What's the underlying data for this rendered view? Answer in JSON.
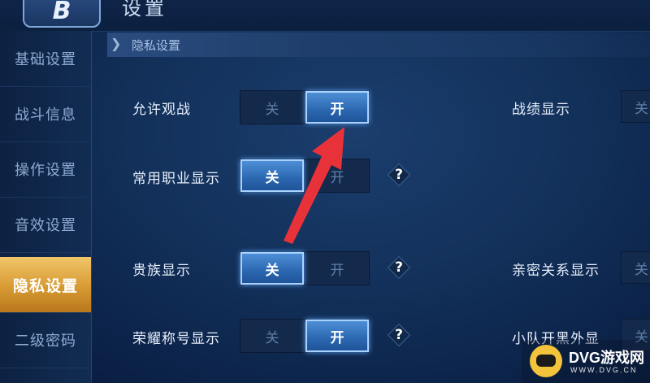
{
  "header": {
    "logo_letter": "B",
    "title": "设置"
  },
  "sidebar": {
    "items": [
      {
        "label": "基础设置",
        "active": false
      },
      {
        "label": "战斗信息",
        "active": false
      },
      {
        "label": "操作设置",
        "active": false
      },
      {
        "label": "音效设置",
        "active": false
      },
      {
        "label": "隐私设置",
        "active": true
      },
      {
        "label": "二级密码",
        "active": false
      }
    ]
  },
  "section": {
    "title": "隐私设置"
  },
  "toggle_labels": {
    "off": "关",
    "on": "开"
  },
  "settings": [
    {
      "label": "允许观战",
      "value": "开",
      "help": ""
    },
    {
      "label": "常用职业显示",
      "value": "关",
      "help": "?"
    },
    {
      "label": "贵族显示",
      "value": "关",
      "help": "?"
    },
    {
      "label": "荣耀称号显示",
      "value": "开",
      "help": "?"
    }
  ],
  "right_settings": [
    {
      "label": "战绩显示",
      "stub": "关"
    },
    {
      "label": "亲密关系显示",
      "stub": "关"
    },
    {
      "label": "小队开黑外显",
      "stub": "关"
    }
  ],
  "watermark": {
    "text": "DVG游戏网",
    "sub": "WWW.DVG.CN"
  },
  "colors": {
    "accent_active_tab": "#d79a33",
    "toggle_on": "#2b67b0",
    "arrow": "#e8323a"
  }
}
